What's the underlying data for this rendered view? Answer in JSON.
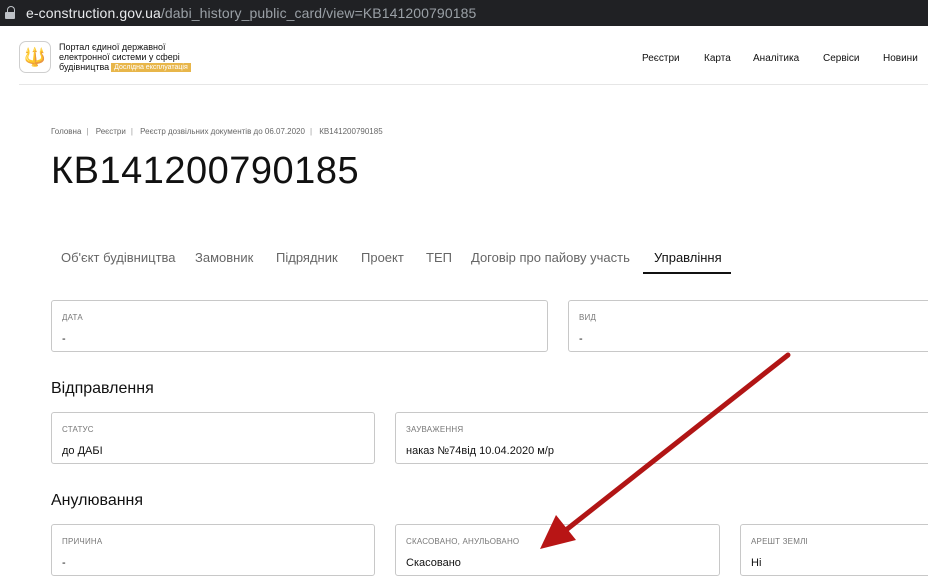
{
  "browser": {
    "url_host": "e-construction.gov.ua",
    "url_path": "/dabi_history_public_card/view=KB141200790185"
  },
  "header": {
    "logo_glyph": "🔱",
    "brand_line1": "Портал єдиної державної",
    "brand_line2": "електронної системи у сфері",
    "brand_line3": "будівництва",
    "badge": "Дослідна експлуатація",
    "nav": [
      "Реєстри",
      "Карта",
      "Аналітика",
      "Сервіси",
      "Новини"
    ]
  },
  "breadcrumb": [
    "Головна",
    "Реєстри",
    "Реєстр дозвільних документів до 06.07.2020",
    "КВ141200790185"
  ],
  "page_title": "КВ141200790185",
  "tabs": [
    "Об'єкт будівництва",
    "Замовник",
    "Підрядник",
    "Проект",
    "ТЕП",
    "Договір про пайову участь",
    "Управління"
  ],
  "active_tab": "Управління",
  "top_fields": {
    "date": {
      "label": "Дата",
      "value": "-"
    },
    "kind": {
      "label": "Вид",
      "value": "-"
    }
  },
  "sending": {
    "heading": "Відправлення",
    "status": {
      "label": "Статус",
      "value": "до ДАБІ"
    },
    "remarks": {
      "label": "Зауваження",
      "value": "наказ №74від 10.04.2020 м/р"
    }
  },
  "annulment": {
    "heading": "Анулювання",
    "reason": {
      "label": "Причина",
      "value": "-"
    },
    "cancelled": {
      "label": "Скасовано, анульовано",
      "value": "Скасовано"
    },
    "land_arrest": {
      "label": "Арешт землі",
      "value": "Ні"
    }
  },
  "colors": {
    "badge": "#e8b64a",
    "annotation_arrow": "#b31515"
  }
}
